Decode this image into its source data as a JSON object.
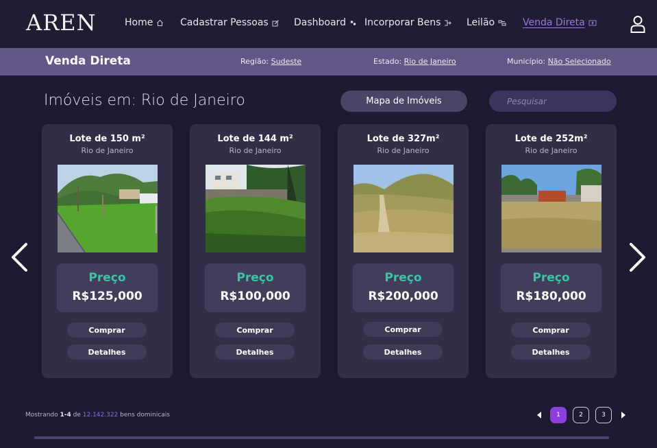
{
  "app": {
    "logo": "AREN"
  },
  "nav": [
    {
      "label": "Home",
      "icon": "home-icon"
    },
    {
      "label": "Cadastrar Pessoas",
      "icon": "edit-icon"
    },
    {
      "label": "Dashboard",
      "icon": "dashboard-icon"
    },
    {
      "label": "Incorporar Bens",
      "icon": "merge-icon"
    },
    {
      "label": "Leilão",
      "icon": "gavel-icon"
    },
    {
      "label": "Venda Direta",
      "icon": "dollar-icon",
      "active": true
    }
  ],
  "subheader": {
    "title": "Venda Direta",
    "regiao_label": "Região: ",
    "regiao": "Sudeste",
    "estado_label": "Estado: ",
    "estado": "Rio de Janeiro",
    "municipio_label": "Município: ",
    "municipio": "Não Selecionado"
  },
  "main": {
    "heading": "Imóveis em: Rio de Janeiro",
    "map_button": "Mapa de Imóveis",
    "search_placeholder": "Pesquisar"
  },
  "cards": [
    {
      "title": "Lote de 150 m²",
      "city": "Rio de Janeiro",
      "price_label": "Preço",
      "price": "R$125,000",
      "buy": "Comprar",
      "details": "Detalhes"
    },
    {
      "title": "Lote de 144 m²",
      "city": "Rio de Janeiro",
      "price_label": "Preço",
      "price": "R$100,000",
      "buy": "Comprar",
      "details": "Detalhes"
    },
    {
      "title": "Lote de 327m²",
      "city": "Rio de Janeiro",
      "price_label": "Preço",
      "price": "R$200,000",
      "buy": "Comprar",
      "details": "Detalhes"
    },
    {
      "title": "Lote de 252m²",
      "city": "Rio de Janeiro",
      "price_label": "Preço",
      "price": "R$180,000",
      "buy": "Comprar",
      "details": "Detalhes"
    }
  ],
  "footer": {
    "prefix": "Mostrando ",
    "range": "1-4",
    "de": " de ",
    "total": "12.142.322",
    "suffix": " bens dominicais",
    "pages": [
      "1",
      "2",
      "3"
    ],
    "current_page": "1"
  },
  "colors": {
    "background": "#1e1a31",
    "subheader": "#635788",
    "accent": "#8b3fe0",
    "price": "#36c9a6"
  }
}
